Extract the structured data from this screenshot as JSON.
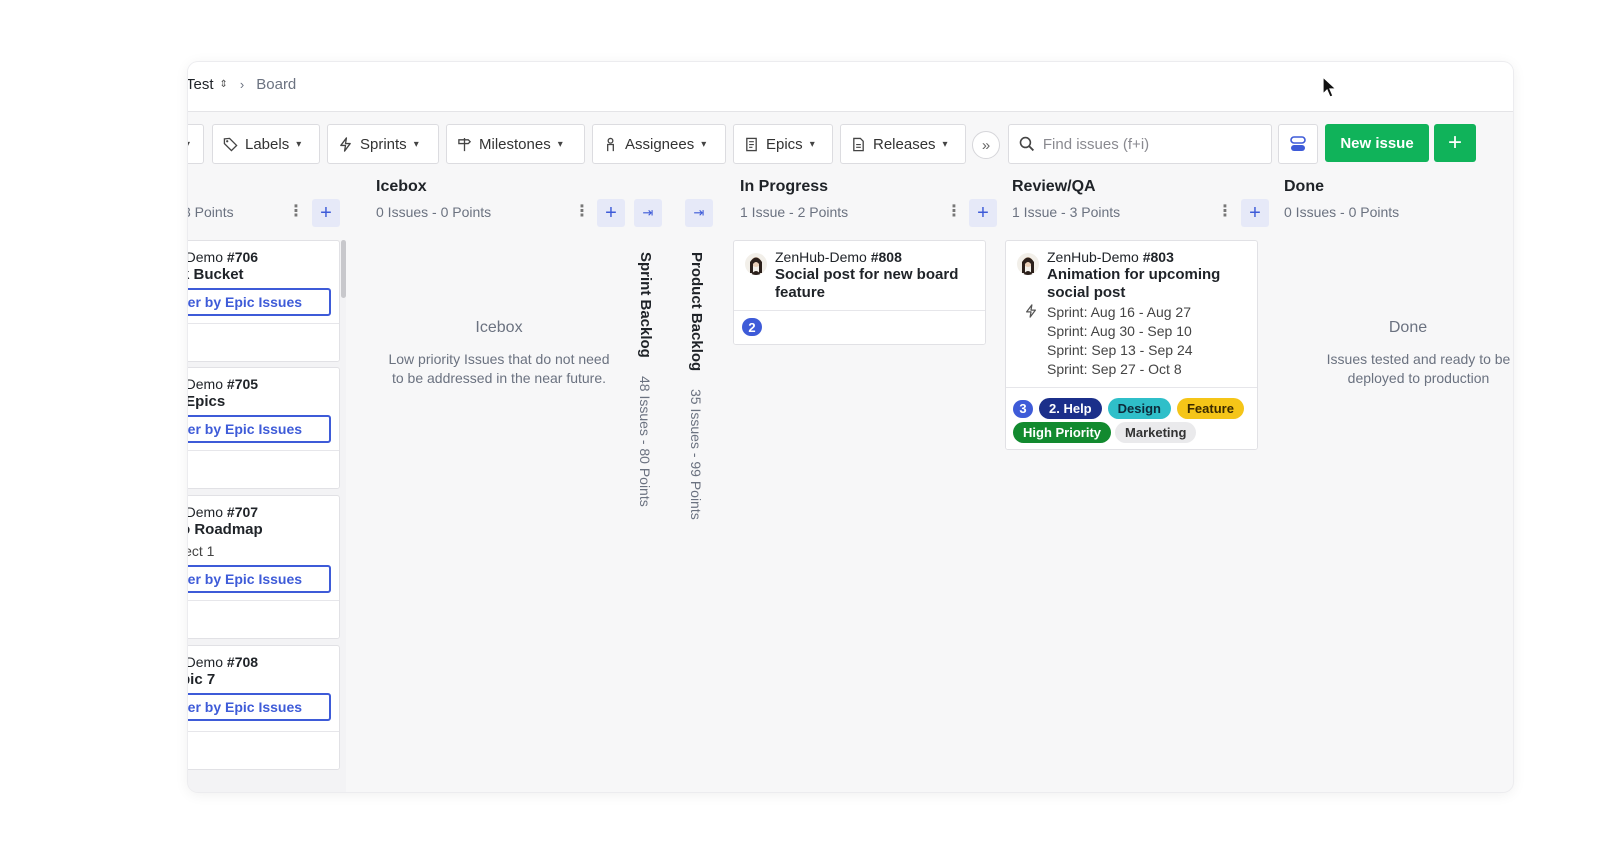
{
  "breadcrumb": {
    "workspace": "Test",
    "current": "Board"
  },
  "filters": [
    {
      "label": "Labels",
      "icon": "tag-icon"
    },
    {
      "label": "Sprints",
      "icon": "lightning-icon"
    },
    {
      "label": "Milestones",
      "icon": "signpost-icon"
    },
    {
      "label": "Assignees",
      "icon": "person-icon"
    },
    {
      "label": "Epics",
      "icon": "document-icon"
    },
    {
      "label": "Releases",
      "icon": "file-icon"
    }
  ],
  "search": {
    "placeholder": "Find issues (f+i)"
  },
  "actions": {
    "new_issue": "New issue",
    "plus": "+"
  },
  "left_column": {
    "meta": "3 Points",
    "cards": [
      {
        "repo_prefix": "-Demo ",
        "number": "#706",
        "title": "k Bucket",
        "extra": "",
        "epic_button": "ter by Epic Issues"
      },
      {
        "repo_prefix": "-Demo ",
        "number": "#705",
        "title": " Epics",
        "extra": "",
        "epic_button": "ter by Epic Issues"
      },
      {
        "repo_prefix": "-Demo ",
        "number": "#707",
        "title": "o Roadmap",
        "extra": "ject 1",
        "epic_button": "ter by Epic Issues"
      },
      {
        "repo_prefix": "-Demo ",
        "number": "#708",
        "title": "pic 7",
        "extra": "",
        "epic_button": "ter by Epic Issues"
      }
    ]
  },
  "icebox": {
    "title": "Icebox",
    "meta": "0 Issues - 0 Points",
    "empty_title": "Icebox",
    "empty_desc": "Low priority Issues that do not need to be addressed in the near future."
  },
  "sprint_backlog": {
    "title": "Sprint Backlog",
    "meta": "48 Issues - 80 Points"
  },
  "product_backlog": {
    "title": "Product Backlog",
    "meta": "35 Issues - 99 Points"
  },
  "in_progress": {
    "title": "In Progress",
    "meta": "1 Issue - 2 Points",
    "card": {
      "repo": "ZenHub-Demo",
      "number": "#808",
      "title": "Social post for new board feature",
      "estimate": "2"
    }
  },
  "review_qa": {
    "title": "Review/QA",
    "meta": "1 Issue - 3 Points",
    "card": {
      "repo": "ZenHub-Demo",
      "number": "#803",
      "title": "Animation for upcoming social post",
      "sprints": [
        "Sprint: Aug 16 - Aug 27",
        "Sprint: Aug 30 - Sep 10",
        "Sprint: Sep 13 - Sep 24",
        "Sprint: Sep 27 - Oct 8"
      ],
      "estimate": "3",
      "labels": [
        {
          "text": "2. Help",
          "bg": "#1b2f8a",
          "fg": "#ffffff"
        },
        {
          "text": "Design",
          "bg": "#2fbfc9",
          "fg": "#0d2a3a"
        },
        {
          "text": "Feature",
          "bg": "#f5c518",
          "fg": "#3a2a00"
        },
        {
          "text": "High Priority",
          "bg": "#128a2f",
          "fg": "#ffffff"
        },
        {
          "text": "Marketing",
          "bg": "#eaeaec",
          "fg": "#333333"
        }
      ]
    }
  },
  "done": {
    "title": "Done",
    "meta": "0 Issues - 0 Points",
    "empty_title": "Done",
    "empty_desc": "Issues tested and ready to be deployed to production"
  }
}
